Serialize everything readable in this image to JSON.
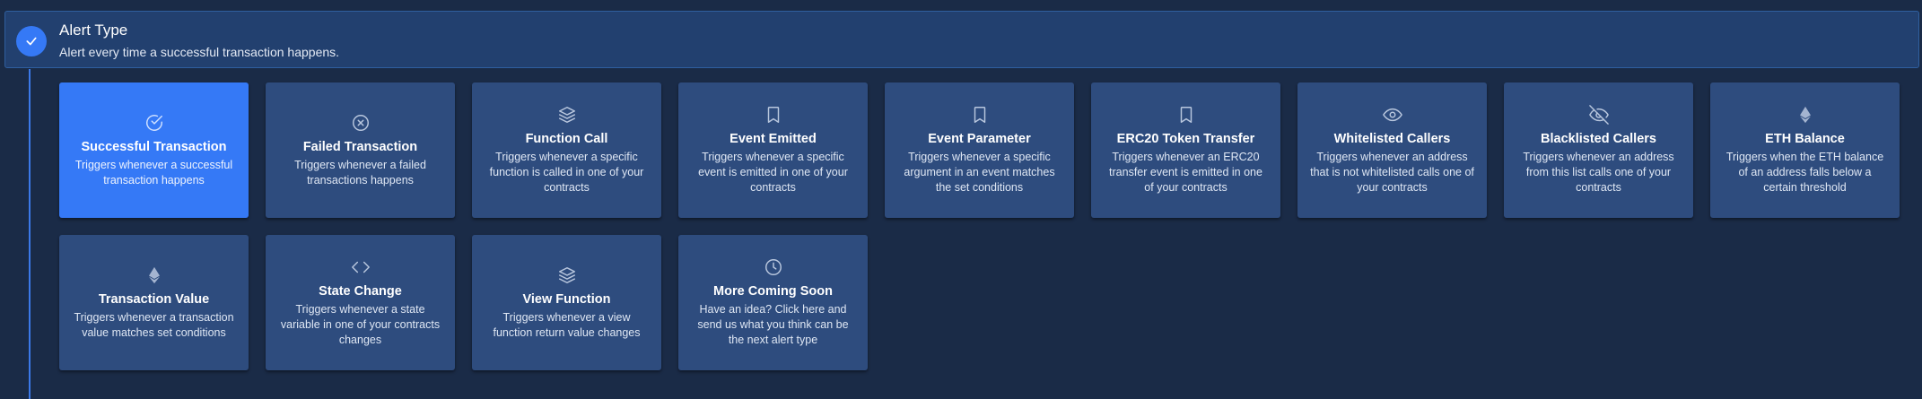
{
  "header": {
    "title": "Alert Type",
    "subtitle": "Alert every time a successful transaction happens.",
    "icon": "check-icon"
  },
  "colors": {
    "background": "#1a2b47",
    "card": "#2e4c7e",
    "selected": "#3579f6",
    "header": "#22406f"
  },
  "cards": [
    {
      "title": "Successful Transaction",
      "desc": "Triggers whenever a successful transaction happens",
      "icon": "check-circle-icon",
      "selected": true
    },
    {
      "title": "Failed Transaction",
      "desc": "Triggers whenever a failed transactions happens",
      "icon": "x-circle-icon",
      "selected": false
    },
    {
      "title": "Function Call",
      "desc": "Triggers whenever a specific function is called in one of your contracts",
      "icon": "layers-icon",
      "selected": false
    },
    {
      "title": "Event Emitted",
      "desc": "Triggers whenever a specific event is emitted in one of your contracts",
      "icon": "bookmark-icon",
      "selected": false
    },
    {
      "title": "Event Parameter",
      "desc": "Triggers whenever a specific argument in an event matches the set conditions",
      "icon": "bookmark-icon",
      "selected": false
    },
    {
      "title": "ERC20 Token Transfer",
      "desc": "Triggers whenever an ERC20 transfer event is emitted in one of your contracts",
      "icon": "bookmark-icon",
      "selected": false
    },
    {
      "title": "Whitelisted Callers",
      "desc": "Triggers whenever an address that is not whitelisted calls one of your contracts",
      "icon": "eye-icon",
      "selected": false
    },
    {
      "title": "Blacklisted Callers",
      "desc": "Triggers whenever an address from this list calls one of your contracts",
      "icon": "eye-off-icon",
      "selected": false
    },
    {
      "title": "ETH Balance",
      "desc": "Triggers when the ETH balance of an address falls below a certain threshold",
      "icon": "ethereum-icon",
      "selected": false
    },
    {
      "title": "Transaction Value",
      "desc": "Triggers whenever a transaction value matches set conditions",
      "icon": "ethereum-icon",
      "selected": false
    },
    {
      "title": "State Change",
      "desc": "Triggers whenever a state variable in one of your contracts changes",
      "icon": "code-icon",
      "selected": false
    },
    {
      "title": "View Function",
      "desc": "Triggers whenever a view function return value changes",
      "icon": "layers-icon",
      "selected": false
    },
    {
      "title": "More Coming Soon",
      "desc": "Have an idea? Click here and send us what you think can be the next alert type",
      "icon": "clock-icon",
      "selected": false
    }
  ]
}
